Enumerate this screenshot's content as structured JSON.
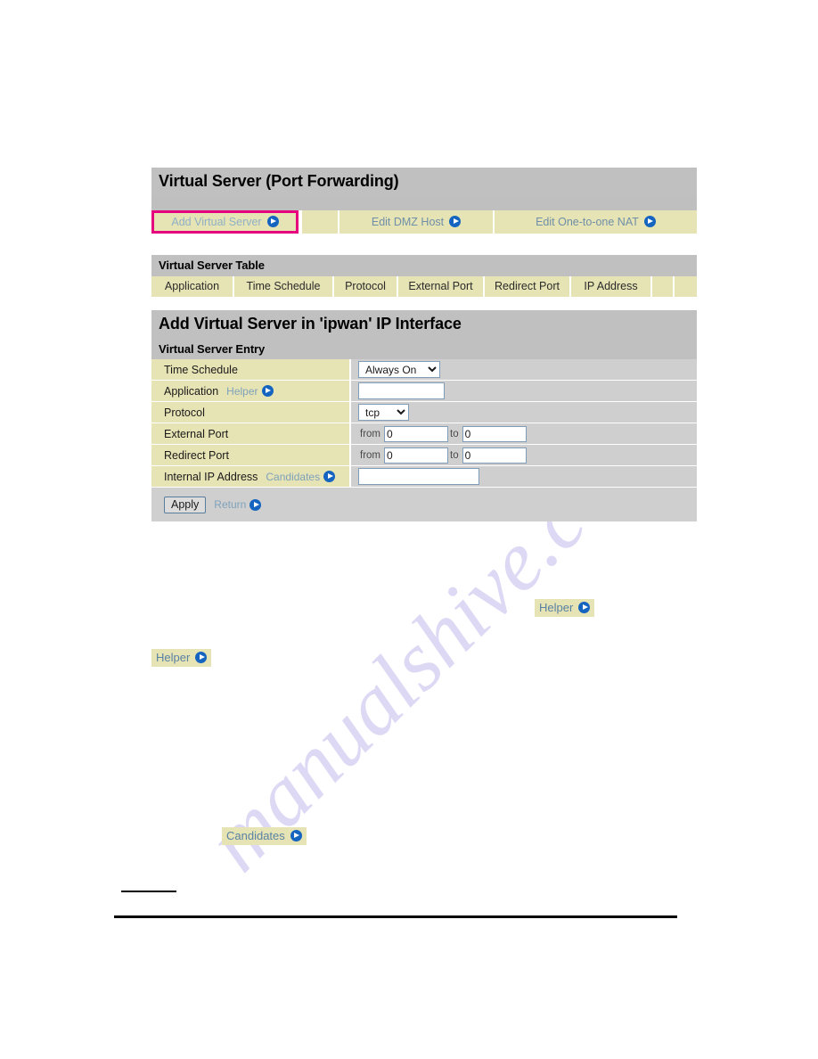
{
  "page": {
    "watermark": "manualshive.com"
  },
  "main_panel": {
    "title": "Virtual Server (Port Forwarding)",
    "tabs": [
      {
        "label": "Add Virtual Server",
        "icon": "arrow-right-circle-icon",
        "selected": true
      },
      {
        "label": "",
        "icon": "",
        "selected": false
      },
      {
        "label": "Edit DMZ Host",
        "icon": "arrow-right-circle-icon",
        "selected": false
      },
      {
        "label": "Edit One-to-one NAT",
        "icon": "arrow-right-circle-icon",
        "selected": false
      }
    ],
    "highlight_color": "#e6007e"
  },
  "virtual_server_table": {
    "title": "Virtual Server Table",
    "columns": [
      "Application",
      "Time Schedule",
      "Protocol",
      "External Port",
      "Redirect Port",
      "IP Address",
      "",
      ""
    ],
    "rows": []
  },
  "entry_form": {
    "title": "Add Virtual Server in 'ipwan' IP Interface",
    "section_title": "Virtual Server Entry",
    "time_schedule": {
      "label": "Time Schedule",
      "value": "Always On",
      "options": [
        "Always On"
      ]
    },
    "application": {
      "label": "Application",
      "helper_label": "Helper",
      "value": "",
      "placeholder": ""
    },
    "protocol": {
      "label": "Protocol",
      "value": "tcp",
      "options": [
        "tcp"
      ]
    },
    "external_port": {
      "label": "External Port",
      "from_label": "from",
      "from_value": "0",
      "to_label": "to",
      "to_value": "0"
    },
    "redirect_port": {
      "label": "Redirect Port",
      "from_label": "from",
      "from_value": "0",
      "to_label": "to",
      "to_value": "0"
    },
    "internal_ip": {
      "label": "Internal IP Address",
      "candidates_label": "Candidates",
      "value": "",
      "placeholder": ""
    },
    "apply_label": "Apply",
    "return_label": "Return"
  },
  "callouts": [
    {
      "label": "Helper",
      "icon": "arrow-right-circle-icon"
    },
    {
      "label": "Helper",
      "icon": "arrow-right-circle-icon"
    },
    {
      "label": "Candidates",
      "icon": "arrow-right-circle-icon"
    }
  ]
}
